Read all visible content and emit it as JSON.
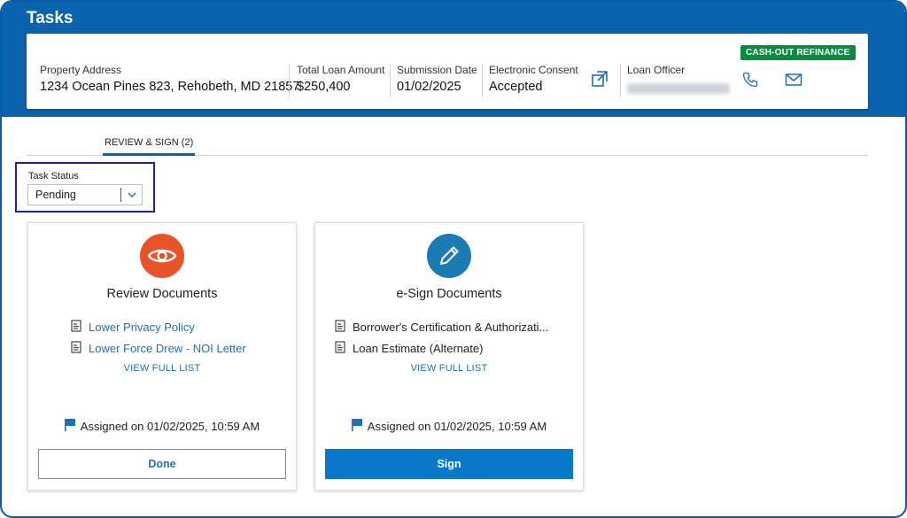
{
  "page": {
    "title": "Tasks"
  },
  "loan_info": {
    "badge": "CASH-OUT REFINANCE",
    "property_address": {
      "label": "Property Address",
      "value": "1234 Ocean Pines 823, Rehobeth, MD 21857"
    },
    "total_loan_amount": {
      "label": "Total Loan Amount",
      "value": "$250,400"
    },
    "submission_date": {
      "label": "Submission Date",
      "value": "01/02/2025"
    },
    "electronic_consent": {
      "label": "Electronic Consent",
      "value": "Accepted"
    },
    "loan_officer": {
      "label": "Loan Officer"
    },
    "icons": {
      "consent": "external-link-icon",
      "phone": "phone-icon",
      "email": "envelope-icon"
    }
  },
  "tabs": [
    {
      "label": "REVIEW & SIGN (2)",
      "active": true
    }
  ],
  "filter": {
    "label": "Task Status",
    "selected": "Pending"
  },
  "cards": [
    {
      "title": "Review Documents",
      "icon": "eye-icon",
      "icon_color": "#e8542a",
      "documents": [
        "Lower Privacy Policy",
        "Lower Force Drew - NOI Letter"
      ],
      "view_full_list": "VIEW FULL LIST",
      "assigned": "Assigned on 01/02/2025, 10:59 AM",
      "action": "Done"
    },
    {
      "title": "e-Sign Documents",
      "icon": "pencil-icon",
      "icon_color": "#1a7bb5",
      "documents": [
        "Borrower's Certification & Authorizati...",
        "Loan Estimate (Alternate)"
      ],
      "view_full_list": "VIEW FULL LIST",
      "assigned": "Assigned on 01/02/2025, 10:59 AM",
      "action": "Sign"
    }
  ],
  "colors": {
    "header": "#0a63ad",
    "badge": "#0d8a3f",
    "link": "#1d70b8",
    "primary_button": "#0a78c9",
    "highlight": "#1a24a6"
  }
}
